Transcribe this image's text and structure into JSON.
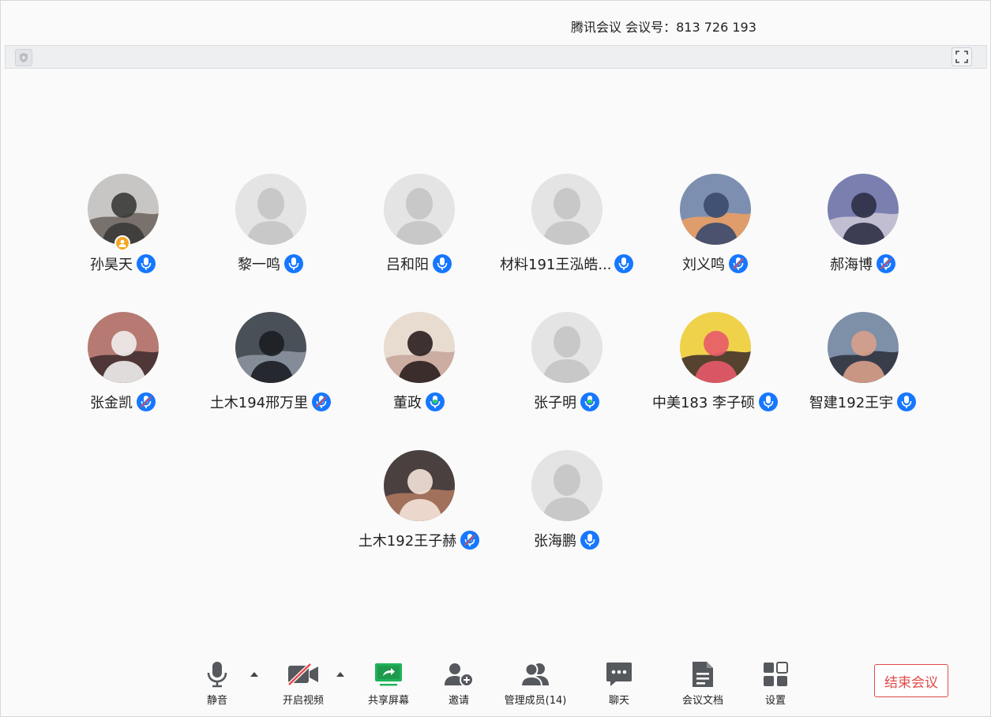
{
  "header": {
    "title": "腾讯会议 会议号：813 726 193"
  },
  "info_bar": {
    "shield_icon": "shield-icon",
    "fullscreen_icon": "fullscreen-icon"
  },
  "participants": [
    {
      "name": "孙昊天",
      "avatar": "photo",
      "host": true,
      "mic": "on"
    },
    {
      "name": "黎一鸣",
      "avatar": "default",
      "host": false,
      "mic": "on"
    },
    {
      "name": "吕和阳",
      "avatar": "default",
      "host": false,
      "mic": "on"
    },
    {
      "name": "材料191王泓皓...",
      "avatar": "default",
      "host": false,
      "mic": "on"
    },
    {
      "name": "刘义鸣",
      "avatar": "photo",
      "host": false,
      "mic": "muted"
    },
    {
      "name": "郝海博",
      "avatar": "photo",
      "host": false,
      "mic": "muted"
    },
    {
      "name": "张金凯",
      "avatar": "photo",
      "host": false,
      "mic": "muted"
    },
    {
      "name": "土木194邢万里",
      "avatar": "photo",
      "host": false,
      "mic": "muted"
    },
    {
      "name": "董政",
      "avatar": "photo",
      "host": false,
      "mic": "speaking"
    },
    {
      "name": "张子明",
      "avatar": "default",
      "host": false,
      "mic": "speaking"
    },
    {
      "name": "中美183  李子硕",
      "avatar": "photo",
      "host": false,
      "mic": "on"
    },
    {
      "name": "智建192王宇",
      "avatar": "photo",
      "host": false,
      "mic": "on"
    },
    {
      "name": "土木192王子赫",
      "avatar": "photo",
      "host": false,
      "mic": "muted"
    },
    {
      "name": "张海鹏",
      "avatar": "default",
      "host": false,
      "mic": "on"
    }
  ],
  "toolbar": {
    "mute_label": "静音",
    "video_label": "开启视频",
    "share_label": "共享屏幕",
    "invite_label": "邀请",
    "members_label": "管理成员(14)",
    "chat_label": "聊天",
    "docs_label": "会议文档",
    "settings_label": "设置",
    "end_label": "结束会议"
  },
  "colors": {
    "accent_blue": "#1677ff",
    "share_green": "#1fb35a",
    "end_red": "#e04a4a",
    "host_orange": "#f5a623",
    "speaking_green": "#2fcf5a",
    "muted_red": "#e84b4b"
  }
}
